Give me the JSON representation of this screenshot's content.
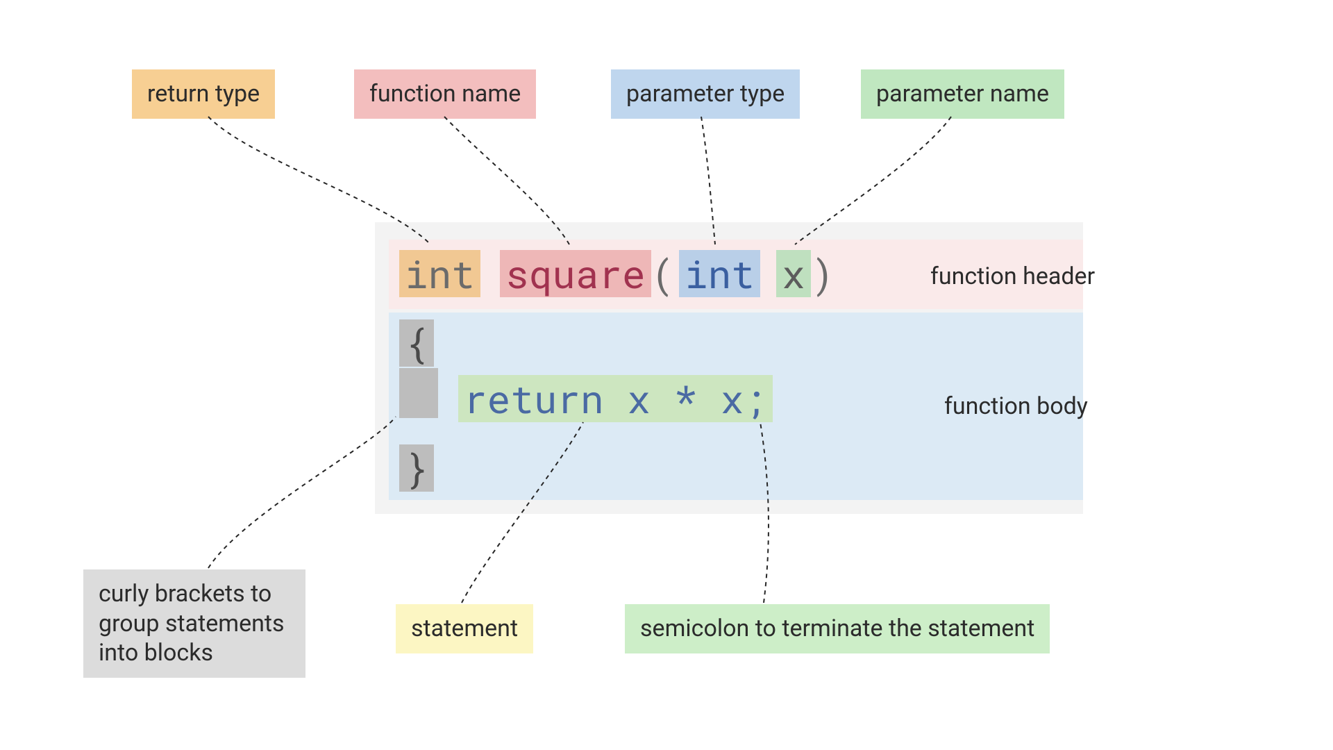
{
  "labels": {
    "return_type": "return type",
    "function_name": "function name",
    "parameter_type": "parameter type",
    "parameter_name": "parameter name",
    "statement": "statement",
    "semicolon": "semicolon to terminate the statement",
    "curly": "curly brackets to group statements into blocks",
    "function_header": "function header",
    "function_body": "function body"
  },
  "code": {
    "return_type": "int",
    "space1": " ",
    "func_name": "square",
    "paren_open": "(",
    "param_type": "int",
    "space2": " ",
    "param_name": "x",
    "paren_close": ")",
    "brace_open": "{",
    "indent": "   ",
    "stmt": "return x * x;",
    "brace_close": "}"
  },
  "colors": {
    "orange": "#f7cf93",
    "pink": "#f3bebe",
    "blue": "#bfd6ee",
    "green": "#c0e7c0",
    "yellow": "#fcf6c3",
    "lgreen": "#cdeec8",
    "grey": "#dcdcdc",
    "card": "#f3f3f3",
    "hdrband": "#faeaea",
    "bodyband": "#dceaf5"
  }
}
